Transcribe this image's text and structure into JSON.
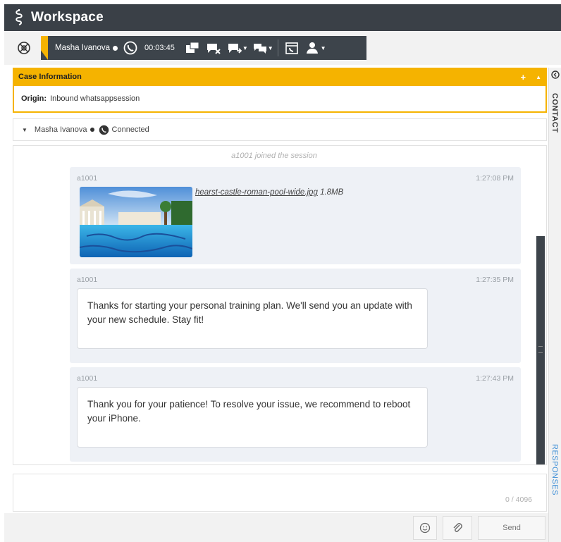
{
  "app": {
    "title": "Workspace"
  },
  "interaction": {
    "contact_name": "Masha Ivanova",
    "timer": "00:03:45"
  },
  "case_info": {
    "header": "Case Information",
    "add_symbol": "+",
    "collapse_symbol": "▲",
    "origin_label": "Origin:",
    "origin_value": "Inbound whatsappsession"
  },
  "side_tabs": {
    "contact": "CONTACT",
    "responses": "RESPONSES"
  },
  "participant": {
    "name": "Masha Ivanova",
    "status": "Connected"
  },
  "transcript": {
    "system_message": "a1001 joined the session",
    "messages": [
      {
        "sender": "a1001",
        "time": "1:27:08 PM",
        "file_name": "hearst-castle-roman-pool-wide.jpg",
        "file_size": "1.8MB"
      },
      {
        "sender": "a1001",
        "time": "1:27:35 PM",
        "text": "Thanks for starting your personal training plan. We'll send you an update with your new schedule. Stay fit!"
      },
      {
        "sender": "a1001",
        "time": "1:27:43 PM",
        "text": "Thank you for your patience! To resolve your issue, we recommend to reboot your iPhone."
      }
    ]
  },
  "composer": {
    "char_count": "0 / 4096"
  },
  "actions": {
    "send_label": "Send"
  },
  "colors": {
    "accent": "#f5b300",
    "toolbar_dark": "#3d444b",
    "titlebar": "#3a4047",
    "link_blue": "#3b8dd6"
  }
}
